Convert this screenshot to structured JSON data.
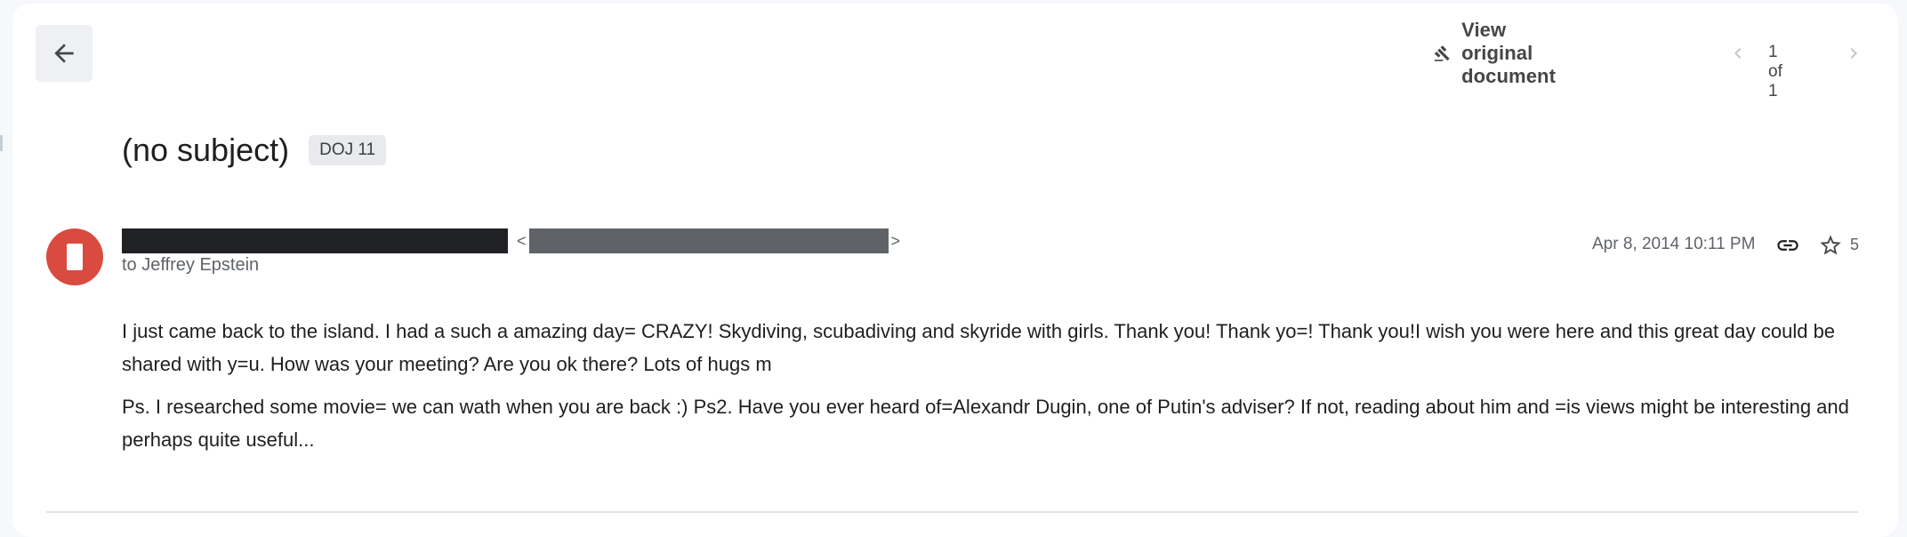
{
  "toolbar": {
    "back_icon": "arrow-back-icon",
    "view_original_label": "View original document",
    "view_original_icon": "gavel-icon",
    "pager_text": "1 of 1",
    "prev_icon": "chevron-left-icon",
    "next_icon": "chevron-right-icon"
  },
  "message": {
    "subject": "(no subject)",
    "label": "DOJ 11",
    "sender_name_redacted": true,
    "sender_email_redacted": true,
    "recipient": "to Jeffrey Epstein",
    "date": "Apr 8, 2014 10:11 PM",
    "star_count": "5",
    "avatar_color": "#d94a3f",
    "body_paragraphs": [
      "I just came back to the island. I had a such a amazing day= CRAZY! Skydiving, scubadiving and skyride with girls. Thank you! Thank yo=! Thank you!I wish you were here and this great day could be shared with y=u. How was your meeting? Are you ok there? Lots of hugs m",
      "Ps. I researched some movie= we can wath when you are back :) Ps2. Have you ever heard of=Alexandr Dugin, one of Putin's adviser? If not, reading about him and =is views might be interesting and perhaps quite useful..."
    ]
  },
  "colors": {
    "background": "#f6f8fc",
    "card": "#ffffff",
    "redaction_dark": "#202124",
    "redaction_gray": "#5f6368"
  }
}
